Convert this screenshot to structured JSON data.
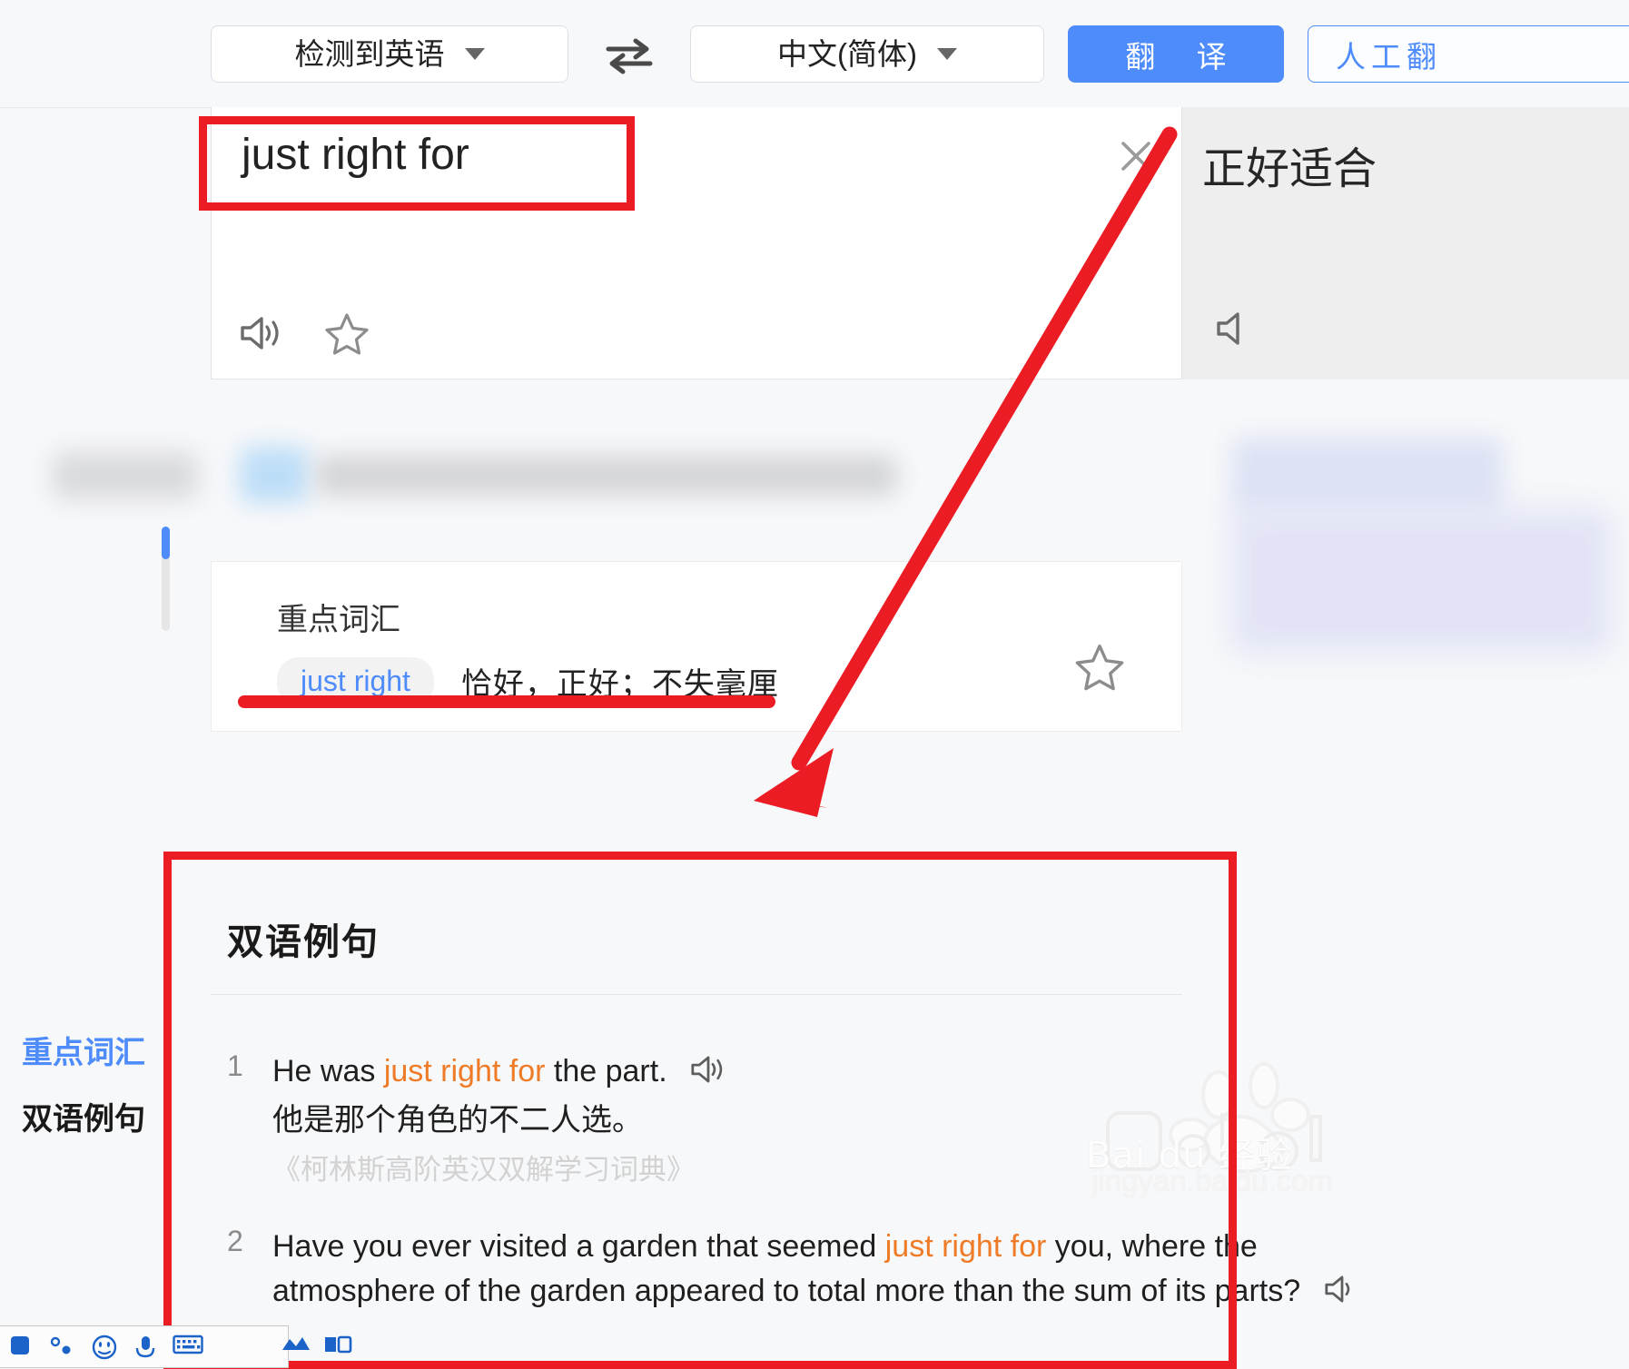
{
  "header": {
    "source_language": "检测到英语",
    "target_language": "中文(简体)",
    "translate_button": "翻  译",
    "human_translate_button": "人工翻",
    "swap_icon": "swap-horizontal-icon",
    "caret_icon": "chevron-down-icon"
  },
  "source_panel": {
    "text": "just right for",
    "clear_icon": "close-icon",
    "speaker_icon": "speaker-icon",
    "favorite_icon": "star-outline-icon"
  },
  "target_panel": {
    "text": "正好适合",
    "speaker_icon": "speaker-icon"
  },
  "side_tabs": [
    {
      "label": "重点词汇",
      "active": true
    },
    {
      "label": "双语例句",
      "active": false
    }
  ],
  "vocabulary": {
    "title": "重点词汇",
    "entries": [
      {
        "term": "just right",
        "definition": "恰好，正好；不失毫厘"
      }
    ],
    "favorite_icon": "star-outline-icon"
  },
  "examples": {
    "heading": "双语例句",
    "items": [
      {
        "number": "1",
        "en_before": "He was ",
        "en_highlight": "just right for",
        "en_after": " the part.",
        "zh": "他是那个角色的不二人选。",
        "source": "《柯林斯高阶英汉双解学习词典》",
        "speaker_icon": "speaker-icon"
      },
      {
        "number": "2",
        "en_before": "Have you ever visited a garden that seemed ",
        "en_highlight": "just right for",
        "en_after": " you, where the atmosphere of the garden appeared to total more than the sum of its parts?",
        "zh": "",
        "source": "",
        "speaker_icon": "speaker-icon"
      }
    ]
  },
  "annotations": {
    "color": "#ec1c24",
    "input_box_highlight": "red-rectangle-around-source-text",
    "vocab_underline": "red-underline-under-vocabulary-entry",
    "examples_box_highlight": "red-rectangle-around-bilingual-examples",
    "arrow": "red-arrow-pointing-to-examples"
  },
  "watermark": {
    "brand": "Bai du 经验",
    "url": "jingyan.baidu.com"
  },
  "ime_toolbar": {
    "icons": [
      "ime-logo-icon",
      "pinyin-mode-icon",
      "emoji-icon",
      "microphone-icon",
      "keyboard-icon",
      "toolbox-icon",
      "skin-icon"
    ]
  },
  "colors": {
    "accent_blue": "#4e8bfb",
    "highlight_orange": "#ef7b26",
    "annotation_red": "#ec1c24",
    "page_bg": "#f7f8fa"
  }
}
